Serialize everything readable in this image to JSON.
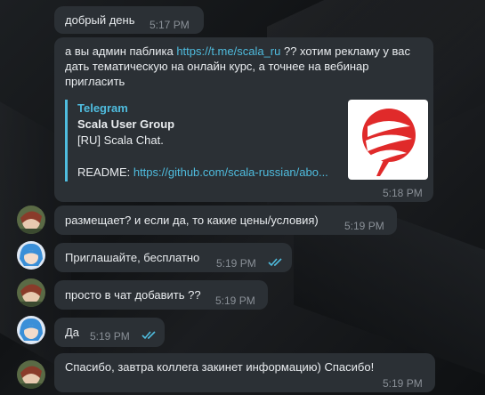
{
  "messages": [
    {
      "text": "добрый день",
      "time": "5:17 PM"
    },
    {
      "pre": "а вы админ паблика ",
      "link": "https://t.me/scala_ru",
      "post": " ?? хотим рекламу у вас дать тематическую на онлайн курс, а точнее на вебинар пригласить",
      "preview": {
        "site": "Telegram",
        "title": "Scala User Group",
        "desc": "[RU] Scala Chat.",
        "readme_label": "README: ",
        "readme_link": "https://github.com/scala-russian/abo..."
      },
      "time": "5:18 PM"
    },
    {
      "text": "размещает? и если да, то какие цены/условия)",
      "time": "5:19 PM"
    },
    {
      "text": "Приглашайте, бесплатно",
      "time": "5:19 PM"
    },
    {
      "text": "просто в чат добавить ??",
      "time": "5:19 PM"
    },
    {
      "text": "Да",
      "time": "5:19 PM"
    },
    {
      "text": "Спасибо, завтра коллега закинет информацию) Спасибо!",
      "time": "5:19 PM"
    }
  ],
  "colors": {
    "accent": "#4fbcde",
    "bubble": "#2b3035",
    "text": "#e9ecef",
    "logo_red": "#e02a2a"
  }
}
